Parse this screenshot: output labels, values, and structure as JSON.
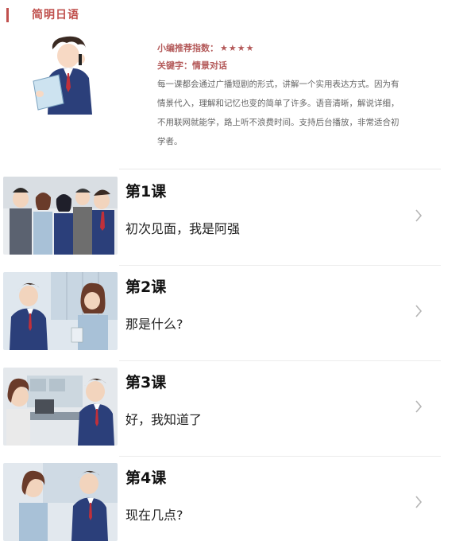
{
  "header": {
    "title": "简明日语"
  },
  "intro": {
    "rating_label": "小编推荐指数：",
    "rating_stars": "★★★★",
    "keyword_label": "关键字：情景对话",
    "desc_lines": [
      "每一课都会通过广播短剧的形式，讲解一个实用表达方式。因为有",
      "情景代入，理解和记忆也变的简单了许多。语音清晰，解说详细，",
      "不用联网就能学，路上听不浪费时间。支持后台播放，非常适合初",
      "学者。"
    ]
  },
  "lessons": [
    {
      "num": "第1课",
      "title": "初次见面，我是阿强"
    },
    {
      "num": "第2课",
      "title": "那是什么?"
    },
    {
      "num": "第3课",
      "title": "好，我知道了"
    },
    {
      "num": "第4课",
      "title": "现在几点?"
    }
  ],
  "colors": {
    "accent": "#c0504d",
    "intro_text": "#b45a5a",
    "suit": "#2b3f7a"
  }
}
